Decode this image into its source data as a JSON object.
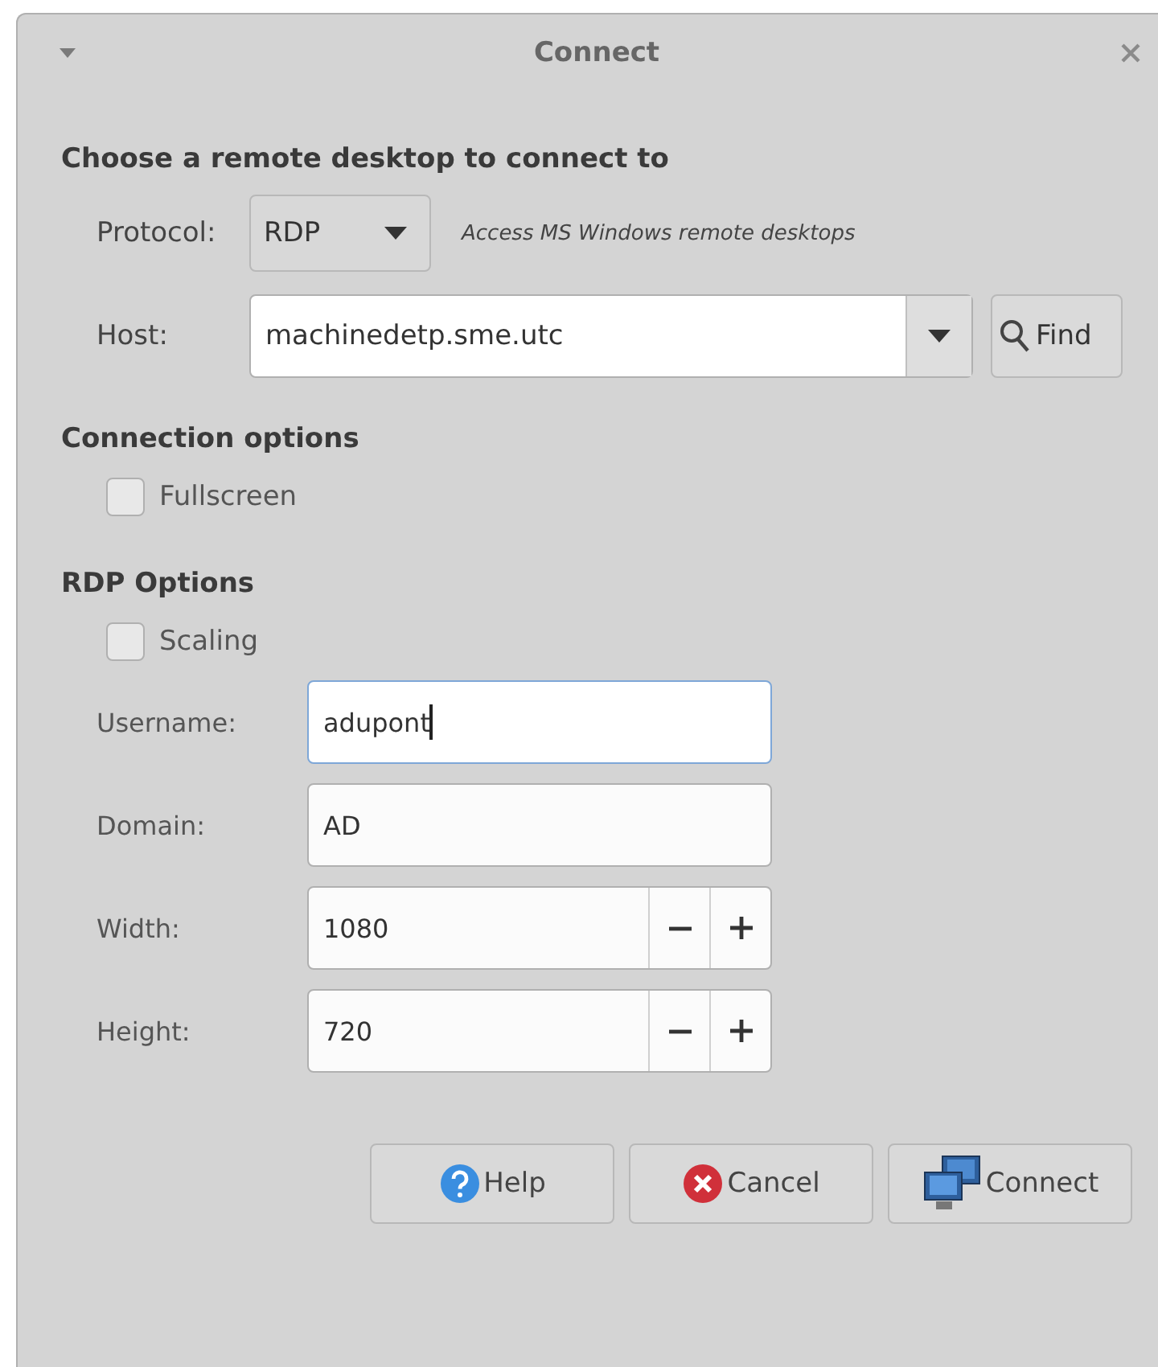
{
  "window": {
    "title": "Connect"
  },
  "heading": "Choose a remote desktop to connect to",
  "protocol": {
    "label": "Protocol:",
    "value": "RDP",
    "description": "Access MS Windows remote desktops"
  },
  "host": {
    "label": "Host:",
    "value": "machinedetp.sme.utc",
    "find_button": "Find"
  },
  "connection_options": {
    "heading": "Connection options",
    "checkboxes": [
      {
        "label": "Fullscreen",
        "checked": false
      }
    ]
  },
  "rdp_options": {
    "heading": "RDP Options",
    "checkboxes": [
      {
        "label": "Scaling",
        "checked": false
      }
    ],
    "fields": [
      {
        "kind": "text",
        "label": "Username:",
        "value": "adupont",
        "focused": true
      },
      {
        "kind": "text",
        "label": "Domain:",
        "value": "AD",
        "focused": false
      },
      {
        "kind": "spin",
        "label": "Width:",
        "value": "1080",
        "focused": false
      },
      {
        "kind": "spin",
        "label": "Height:",
        "value": "720",
        "focused": false
      }
    ]
  },
  "buttons": [
    {
      "kind": "help",
      "label": "Help"
    },
    {
      "kind": "cancel",
      "label": "Cancel"
    },
    {
      "kind": "connect",
      "label": "Connect"
    }
  ]
}
